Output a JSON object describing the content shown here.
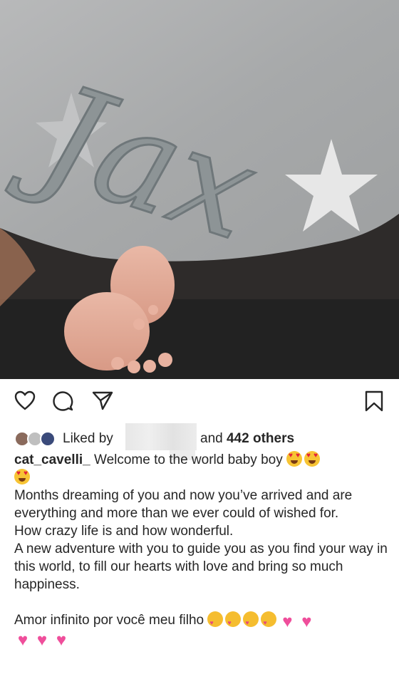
{
  "photo": {
    "embroidered_name": "Jax",
    "description_icon": "baby-feet-under-blanket"
  },
  "actions": {
    "like_icon": "heart-outline-icon",
    "comment_icon": "comment-icon",
    "share_icon": "send-icon",
    "save_icon": "bookmark-icon"
  },
  "likes": {
    "prefix": "Liked by",
    "suffix_and": "and",
    "others_count": "442 others"
  },
  "caption": {
    "username": "cat_cavelli_",
    "line1": "Welcome to the world baby boy",
    "para1": "Months dreaming of you and now you’ve arrived and are everything and more than we ever could of wished for.",
    "para2": "How crazy life is and how wonderful.",
    "para3": "A new adventure with you to guide you as you find your way in this world, to fill our hearts with love and bring so much happiness.",
    "para4": "Amor infinito por você meu filho"
  },
  "colors": {
    "text": "#262626",
    "emoji_yellow": "#f7c434",
    "pink_heart": "#ef4e9b"
  }
}
